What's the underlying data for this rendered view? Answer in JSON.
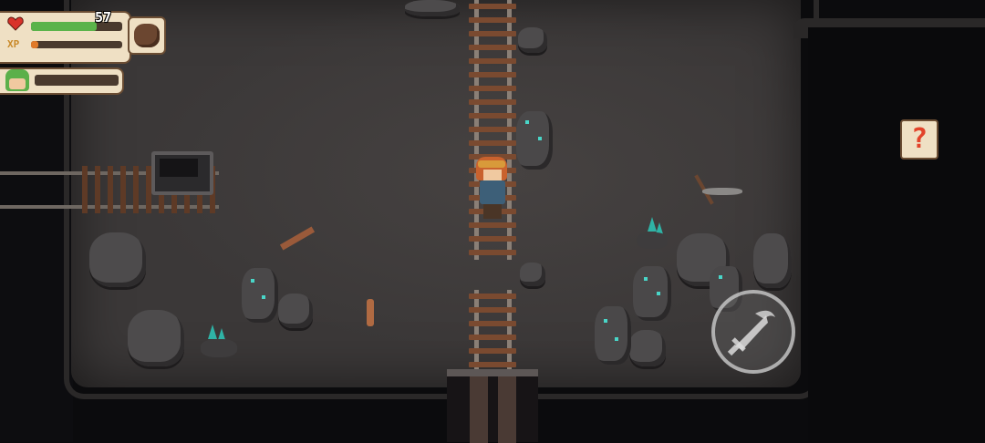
{
  "hud": {
    "hp_value": "57",
    "hp_fraction": 0.72,
    "xp_label": "XP",
    "xp_fraction": 0.08,
    "ally_hp_fraction": 0.0
  },
  "help_button": {
    "label": "?"
  },
  "icons": {
    "heart": "heart-icon",
    "pet": "pet-portrait",
    "ally": "ally-portrait",
    "attack": "sword-attack-icon"
  },
  "colors": {
    "hp_bar": "#5ab34a",
    "xp_bar": "#e07a2a",
    "help_mark": "#e2432a",
    "ore_glow": "#49d6c8"
  }
}
